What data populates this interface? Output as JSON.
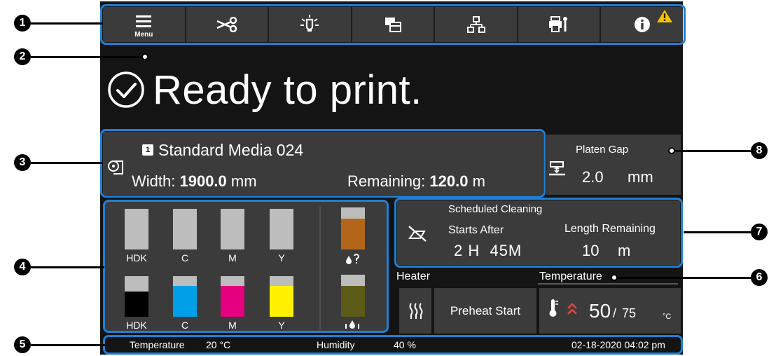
{
  "toolbar": {
    "menu_label": "Menu",
    "buttons": [
      "menu-icon",
      "cut-icon",
      "light-icon",
      "window-icon",
      "network-icon",
      "maintenance-icon",
      "info-icon"
    ],
    "warning_icon": "warning-icon"
  },
  "status": {
    "icon": "check-circle-icon",
    "text": "Ready to print."
  },
  "media": {
    "number": "1",
    "name": "Standard Media 024",
    "width_label": "Width:",
    "width_value": "1900.0",
    "width_unit": "mm",
    "remaining_label": "Remaining:",
    "remaining_value": "120.0",
    "remaining_unit": "m",
    "icon": "media-roll-icon"
  },
  "platen": {
    "title": "Platen Gap",
    "value": "2.0",
    "unit": "mm",
    "icon": "platen-gap-icon"
  },
  "ink": {
    "top_labels": [
      "HDK",
      "C",
      "M",
      "Y"
    ],
    "bottom_labels": [
      "HDK",
      "C",
      "M",
      "Y"
    ],
    "bottom_fills": [
      "#000000",
      "#00a0e9",
      "#e4007f",
      "#fff100"
    ],
    "waste_colors": {
      "upper": "#b3661a",
      "lower": "#5c5b18"
    },
    "waste_icons": [
      "waste-ink-icon",
      "waste-ink-tray-icon"
    ]
  },
  "cleaning": {
    "icon": "cleaning-off-icon",
    "title": "Scheduled Cleaning",
    "starts_label": "Starts After",
    "starts_value": "2 H  45M",
    "length_label": "Length Remaining",
    "length_value": "10",
    "length_unit": "m"
  },
  "heater": {
    "label": "Heater",
    "temperature_label": "Temperature",
    "preheat_label": "Preheat Start",
    "current": "50",
    "separator": "/",
    "target": "75",
    "unit": "°C",
    "icons": [
      "heater-icon",
      "thermometer-icon",
      "heating-up-icon"
    ]
  },
  "bottom_bar": {
    "temperature_label": "Temperature",
    "temperature_value": "20 °C",
    "humidity_label": "Humidity",
    "humidity_value": "40 %",
    "datetime": "02-18-2020 04:02 pm"
  },
  "callouts": [
    "1",
    "2",
    "3",
    "4",
    "5",
    "6",
    "7",
    "8"
  ],
  "colors": {
    "accent": "#1e7fd6",
    "screen": "#141414",
    "panel": "#3b3b3b",
    "warning": "#f5c400"
  }
}
